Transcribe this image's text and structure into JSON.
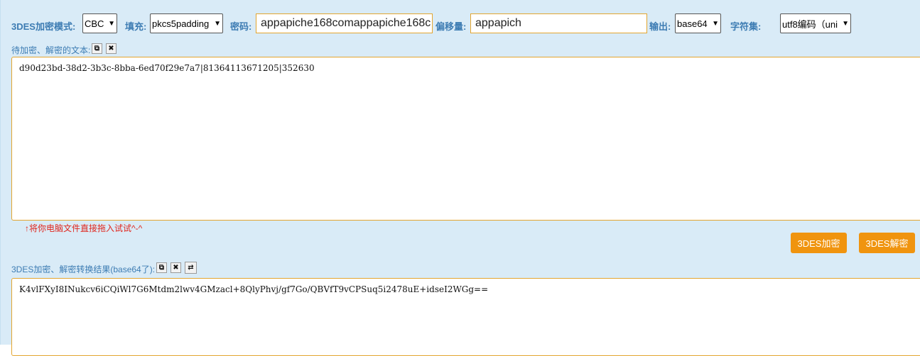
{
  "toolbar": {
    "mode_label": "3DES加密模式:",
    "mode_value": "CBC",
    "padding_label": "填充:",
    "padding_value": "pkcs5padding",
    "password_label": "密码:",
    "password_value": "appapiche168comappapiche168c",
    "offset_label": "偏移量:",
    "offset_value": "appapich",
    "output_label": "输出:",
    "output_value": "base64",
    "charset_label": "字符集:",
    "charset_value": "utf8编码（uni"
  },
  "input": {
    "label": "待加密、解密的文本:",
    "text": "d90d23bd-38d2-3b3c-8bba-6ed70f29e7a7|81364113671205|352630",
    "hint": "↑将你电脑文件直接拖入试试^-^"
  },
  "actions": {
    "encrypt_label": "3DES加密",
    "decrypt_label": "3DES解密"
  },
  "output": {
    "label": "3DES加密、解密转换结果(base64了):",
    "text": "K4vlFXyI8INukcv6iCQiWl7G6Mtdm2lwv4GMzacl+8QlyPhvj/gf7Go/QBVfT9vCPSuq5i2478uE+idseI2WGg=="
  },
  "icons": {
    "copy": "copy-icon",
    "clear": "clear-icon",
    "swap": "swap-icon"
  }
}
